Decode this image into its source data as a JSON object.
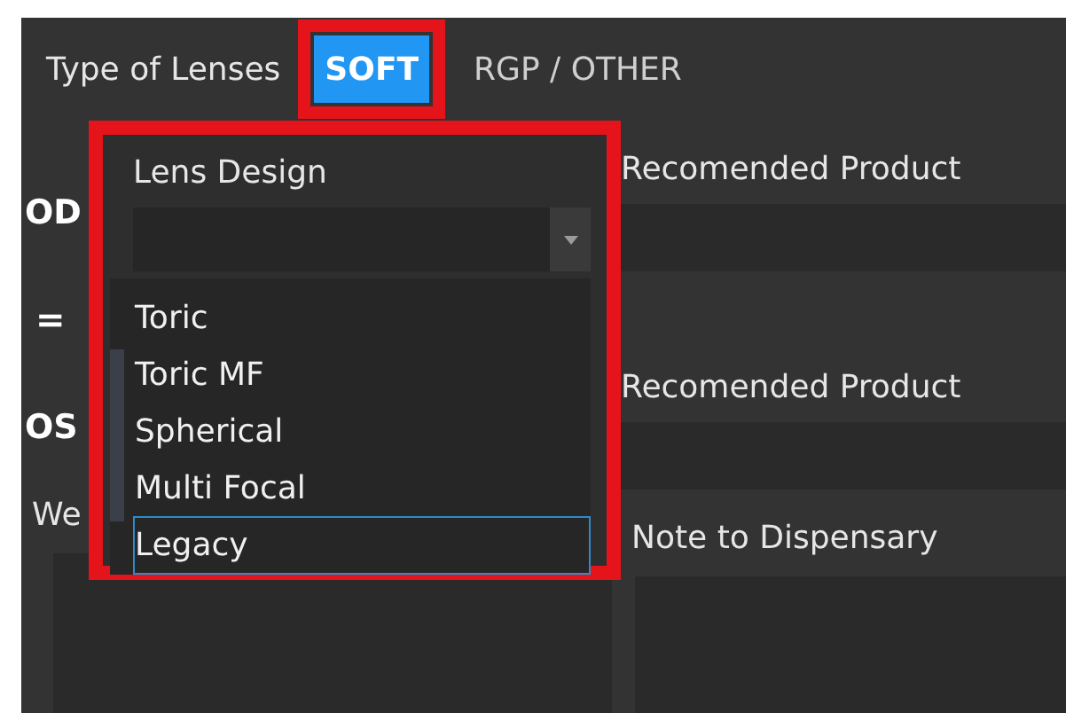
{
  "header": {
    "label": "Type of Lenses",
    "tabs": [
      {
        "label": "SOFT",
        "selected": true,
        "highlighted": true
      },
      {
        "label": "RGP / OTHER",
        "selected": false,
        "highlighted": false
      }
    ]
  },
  "left_column": {
    "od_label": "OD",
    "equals": "=",
    "os_label": "OS",
    "wear_label": "We"
  },
  "right_column": {
    "od_product_label": "Recomended Product",
    "os_product_label": "Recomended Product",
    "note_label": "Note to Dispensary"
  },
  "lens_design": {
    "label": "Lens Design",
    "highlighted": true,
    "options": [
      {
        "label": "Toric",
        "selected": false
      },
      {
        "label": "Toric MF",
        "selected": false
      },
      {
        "label": "Spherical",
        "selected": false
      },
      {
        "label": "Multi Focal",
        "selected": false
      },
      {
        "label": "Legacy",
        "selected": true
      }
    ]
  }
}
